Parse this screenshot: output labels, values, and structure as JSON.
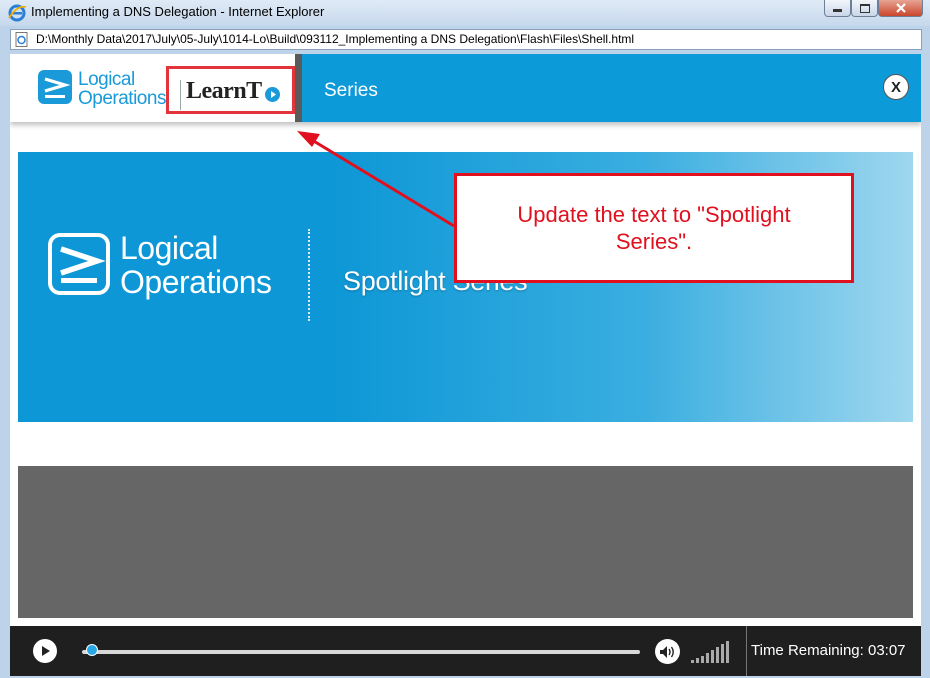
{
  "window": {
    "title": "Implementing a DNS Delegation - Internet Explorer",
    "address": "D:\\Monthly Data\\2017\\July\\05-July\\1014-Lo\\Build\\093112_Implementing a DNS Delegation\\Flash\\Files\\Shell.html"
  },
  "header": {
    "logo_line1": "Logical",
    "logo_line2": "Operations",
    "learnto": "LearnT",
    "series_label": "Series",
    "close_label": "X"
  },
  "banner": {
    "logo_line1": "Logical",
    "logo_line2": "Operations",
    "title": "Spotlight Series"
  },
  "callout": {
    "text": "Update the text to \"Spotlight Series\"."
  },
  "player": {
    "progress": 0.01,
    "time_remaining": "Time Remaining: 03:07"
  },
  "colors": {
    "brand_blue": "#0d9ad9",
    "annotation_red": "#e0101e"
  }
}
